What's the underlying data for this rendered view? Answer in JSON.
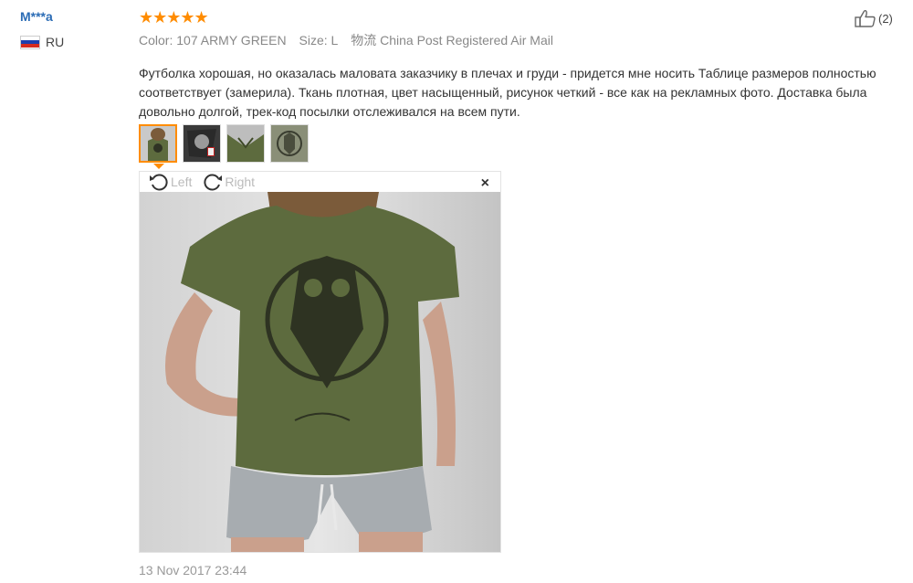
{
  "reviewer": {
    "name": "M***a",
    "country_code": "RU"
  },
  "rating": {
    "stars": "★★★★★",
    "value": 5,
    "max": 5
  },
  "attributes": {
    "color_label": "Color:",
    "color_value": "107 ARMY GREEN",
    "size_label": "Size:",
    "size_value": "L",
    "shipping_label": "物流",
    "shipping_value": "China Post Registered Air Mail"
  },
  "helpful": {
    "count": "(2)",
    "icon": "thumbs-up-icon"
  },
  "review_text": "Футболка хорошая, но оказалась маловата заказчику в плечах и груди - придется мне носить Таблице размеров полностью соответствует (замерила). Ткань плотная, цвет насыщенный, рисунок четкий - все как на рекламных фото. Доставка была довольно долгой, трек-код посылки отслеживался на всем пути.",
  "viewer": {
    "rotate_left": "Left",
    "rotate_right": "Right",
    "close": "×"
  },
  "date": "13 Nov 2017 23:44",
  "colors": {
    "accent": "#ff8c00",
    "name": "#2b6cb5",
    "shirt": "#5d6b3e"
  }
}
